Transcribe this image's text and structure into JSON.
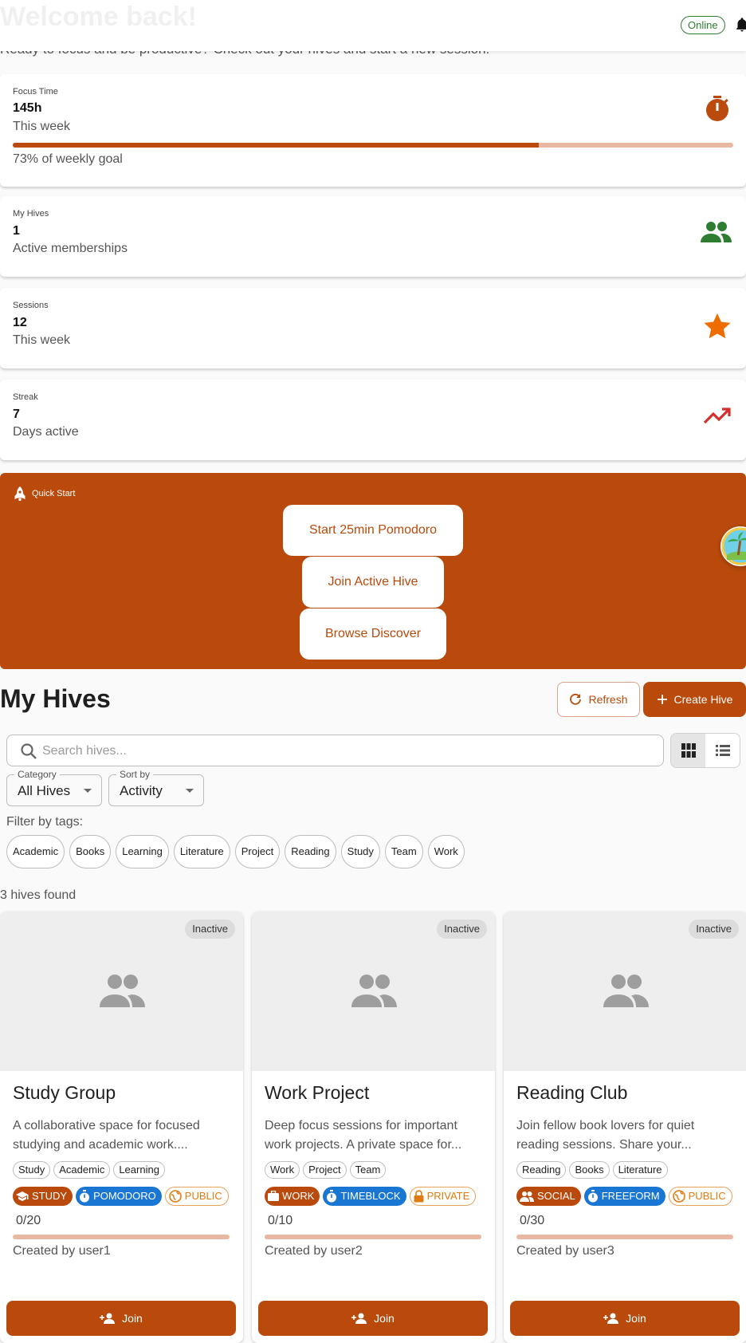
{
  "header": {
    "welcome": "Welcome back!",
    "status": "Online",
    "subtitle": "Ready to focus and be productive? Check out your hives and start a new session."
  },
  "stats": {
    "focus": {
      "label": "Focus Time",
      "value": "145h",
      "sub": "This week",
      "progress_percent": 73,
      "goal": "73% of weekly goal",
      "icon": "timer-icon",
      "color": "#bb4b0d"
    },
    "hives": {
      "label": "My Hives",
      "value": "1",
      "sub": "Active memberships",
      "icon": "group-icon",
      "color": "#2e7d32"
    },
    "sessions": {
      "label": "Sessions",
      "value": "12",
      "sub": "This week",
      "icon": "star-icon",
      "color": "#ef6c00"
    },
    "streak": {
      "label": "Streak",
      "value": "7",
      "sub": "Days active",
      "icon": "trending-up-icon",
      "color": "#d32f2f"
    }
  },
  "quick_start": {
    "title": "Quick Start",
    "buttons": [
      "Start 25min Pomodoro",
      "Join Active Hive",
      "Browse Discover"
    ]
  },
  "my_hives": {
    "title": "My Hives",
    "refresh_label": "Refresh",
    "create_label": "Create Hive",
    "search_placeholder": "Search hives...",
    "category": {
      "label": "Category",
      "value": "All Hives"
    },
    "sort": {
      "label": "Sort by",
      "value": "Activity"
    },
    "filter_label": "Filter by tags:",
    "tags": [
      "Academic",
      "Books",
      "Learning",
      "Literature",
      "Project",
      "Reading",
      "Study",
      "Team",
      "Work"
    ],
    "found": "3 hives found"
  },
  "hives": [
    {
      "status": "Inactive",
      "title": "Study Group",
      "desc_line1": "A collaborative space for focused",
      "desc_line2": "studying and academic work....",
      "tags": [
        "Study",
        "Academic",
        "Learning"
      ],
      "type": "STUDY",
      "timer": "POMODORO",
      "privacy": "PUBLIC",
      "count": "0/20",
      "fill_fraction": 0,
      "creator": "Created by user1",
      "join_label": "Join"
    },
    {
      "status": "Inactive",
      "title": "Work Project",
      "desc_line1": "Deep focus sessions for important",
      "desc_line2": "work projects. A private space for...",
      "tags": [
        "Work",
        "Project",
        "Team"
      ],
      "type": "WORK",
      "timer": "TIMEBLOCK",
      "privacy": "PRIVATE",
      "count": "0/10",
      "fill_fraction": 0,
      "creator": "Created by user2",
      "join_label": "Join"
    },
    {
      "status": "Inactive",
      "title": "Reading Club",
      "desc_line1": "Join fellow book lovers for quiet",
      "desc_line2": "reading sessions. Share your...",
      "tags": [
        "Reading",
        "Books",
        "Literature"
      ],
      "type": "SOCIAL",
      "timer": "FREEFORM",
      "privacy": "PUBLIC",
      "count": "0/30",
      "fill_fraction": 0,
      "creator": "Created by user3",
      "join_label": "Join"
    }
  ],
  "colors": {
    "primary": "#b94a0c",
    "blue": "#1976d2",
    "outline_orange": "#e07b10",
    "online_green": "#2e7d32"
  }
}
